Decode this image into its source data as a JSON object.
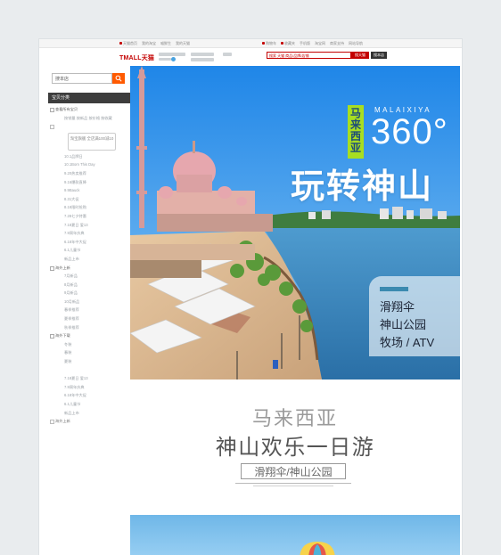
{
  "topbar": {
    "left_links": [
      "天猫首页",
      "我的淘宝",
      "喵鲜生",
      "我的天猫"
    ],
    "right_links": [
      "购物车",
      "收藏夹",
      "手机版",
      "淘宝网",
      "商家支持",
      "网站导航"
    ]
  },
  "header": {
    "logo": "TMALL天猫",
    "search_placeholder": "搜索 天猫 商品/品牌/店铺",
    "search_tmall_button": "搜天猫",
    "search_shop_button": "搜本店"
  },
  "sidebar": {
    "shop_search_placeholder": "搜本店",
    "category_header": "宝贝分类",
    "items": [
      {
        "kind": "sec",
        "text": "查看所有宝贝"
      },
      {
        "kind": "item",
        "text": "按销量 按新品 按价格 按收藏"
      },
      {
        "kind": "sub",
        "text": ""
      },
      {
        "kind": "button",
        "text": "淘宝旗舰 全店满100减10"
      },
      {
        "kind": "item",
        "text": "10.1品牌日"
      },
      {
        "kind": "item",
        "text": "10.1Born This Day"
      },
      {
        "kind": "item",
        "text": "9.20热卖推荐"
      },
      {
        "kind": "item",
        "text": "9.16爆款直降"
      },
      {
        "kind": "item",
        "text": "9.9Bauck"
      },
      {
        "kind": "item",
        "text": "8.31大促"
      },
      {
        "kind": "item",
        "text": "8.18限时抢购"
      },
      {
        "kind": "item",
        "text": "7.28七夕特惠"
      },
      {
        "kind": "item",
        "text": "7.18夏日 爱13"
      },
      {
        "kind": "item",
        "text": "7.9周年庆典"
      },
      {
        "kind": "item",
        "text": "6.18年中大促"
      },
      {
        "kind": "item",
        "text": "6.1儿童节"
      },
      {
        "kind": "item",
        "text": "新品上市"
      },
      {
        "kind": "sec",
        "text": "海外上新"
      },
      {
        "kind": "item",
        "text": "7月新品"
      },
      {
        "kind": "item",
        "text": "8月新品"
      },
      {
        "kind": "item",
        "text": "9月新品"
      },
      {
        "kind": "item",
        "text": "10月新品"
      },
      {
        "kind": "item",
        "text": "春季推荐"
      },
      {
        "kind": "item",
        "text": "夏季推荐"
      },
      {
        "kind": "item",
        "text": "秋季推荐"
      },
      {
        "kind": "sec",
        "text": "海外下载"
      },
      {
        "kind": "item",
        "text": "冬装"
      },
      {
        "kind": "item",
        "text": "春装"
      },
      {
        "kind": "item",
        "text": "夏装"
      },
      {
        "kind": "item",
        "text": ""
      },
      {
        "kind": "item",
        "text": "7.18夏日 爱13"
      },
      {
        "kind": "item",
        "text": "7.9周年庆典"
      },
      {
        "kind": "item",
        "text": "6.18年中大促"
      },
      {
        "kind": "item",
        "text": "6.1儿童节"
      },
      {
        "kind": "item",
        "text": "新品上市"
      },
      {
        "kind": "sub",
        "text": "海外上新"
      }
    ]
  },
  "hero": {
    "tag_vertical": "马来西亚",
    "english": "MALAIXIYA",
    "degree": "360°",
    "title": "玩转神山",
    "info_lines": [
      "滑翔伞",
      "神山公园",
      "牧场 / ATV"
    ]
  },
  "subtitle": {
    "line1": "马来西亚",
    "line2": "神山欢乐一日游",
    "pill": "滑翔伞/神山公园"
  },
  "colors": {
    "brand_red": "#c40000",
    "search_orange": "#ff5a00",
    "tag_green": "#a8de21",
    "sky_blue": "#2f8fe0"
  }
}
